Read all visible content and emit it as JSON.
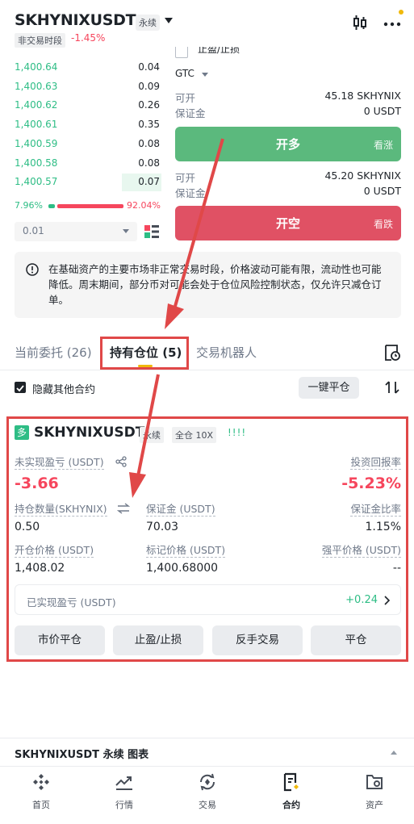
{
  "header": {
    "symbol": "SKHYNIXUSDT",
    "contract_type": "永续",
    "session": "非交易时段",
    "change": "-1.45%"
  },
  "orderbook": {
    "bids": [
      {
        "price": "1,400.64",
        "qty": "0.04",
        "depth": 0.0
      },
      {
        "price": "1,400.63",
        "qty": "0.09",
        "depth": 0.0
      },
      {
        "price": "1,400.62",
        "qty": "0.26",
        "depth": 0.0
      },
      {
        "price": "1,400.61",
        "qty": "0.35",
        "depth": 0.0
      },
      {
        "price": "1,400.59",
        "qty": "0.08",
        "depth": 0.0
      },
      {
        "price": "1,400.58",
        "qty": "0.08",
        "depth": 0.0
      },
      {
        "price": "1,400.57",
        "qty": "0.07",
        "depth": 0.27
      }
    ],
    "buy_ratio": "7.96%",
    "sell_ratio": "92.04%",
    "precision": "0.01"
  },
  "order_form": {
    "tpsl_label": "止盈/止损",
    "time_in_force": "GTC",
    "long": {
      "avail_label": "可开",
      "avail_value": "45.18 SKHYNIX",
      "margin_label": "保证金",
      "margin_value": "0 USDT",
      "button": "开多",
      "sub": "看涨"
    },
    "short": {
      "avail_label": "可开",
      "avail_value": "45.20 SKHYNIX",
      "margin_label": "保证金",
      "margin_value": "0 USDT",
      "button": "开空",
      "sub": "看跌"
    }
  },
  "notice": "在基础资产的主要市场非正常交易时段，价格波动可能有限，流动性也可能降低。周末期间，部分币对可能会处于仓位风险控制状态，仅允许只减仓订单。",
  "tabs": [
    {
      "label": "当前委托 (26)"
    },
    {
      "label": "持有仓位 (5)"
    },
    {
      "label": "交易机器人"
    }
  ],
  "filters": {
    "hide_other": "隐藏其他合约",
    "close_all": "一键平仓"
  },
  "position": {
    "side_tag": "多",
    "symbol": "SKHYNIXUSDT",
    "contract_type": "永续",
    "margin_mode": "全仓 10X",
    "signal_bars": "!!!!",
    "unrealized_label": "未实现盈亏 (USDT)",
    "unrealized_value": "-3.66",
    "roi_label": "投资回报率",
    "roi_value": "-5.23%",
    "size_label": "持仓数量(SKHYNIX)",
    "size_value": "0.50",
    "margin_label": "保证金 (USDT)",
    "margin_value": "70.03",
    "margin_ratio_label": "保证金比率",
    "margin_ratio_value": "1.15%",
    "entry_label": "开仓价格 (USDT)",
    "entry_value": "1,408.02",
    "mark_label": "标记价格 (USDT)",
    "mark_value": "1,400.68000",
    "liq_label": "强平价格 (USDT)",
    "liq_value": "--",
    "realized_label": "已实现盈亏 (USDT)",
    "realized_value": "+0.24",
    "actions": [
      "市价平仓",
      "止盈/止损",
      "反手交易",
      "平仓"
    ]
  },
  "chart_bar": {
    "label": "SKHYNIXUSDT 永续 图表"
  },
  "nav": [
    {
      "label": "首页",
      "icon": "home-icon"
    },
    {
      "label": "行情",
      "icon": "markets-icon"
    },
    {
      "label": "交易",
      "icon": "trade-icon"
    },
    {
      "label": "合约",
      "icon": "futures-icon"
    },
    {
      "label": "资产",
      "icon": "wallet-icon"
    }
  ],
  "colors": {
    "green": "#2ebd85",
    "red": "#f6465d",
    "accent": "#f0b90b",
    "annotation": "#e04848"
  }
}
